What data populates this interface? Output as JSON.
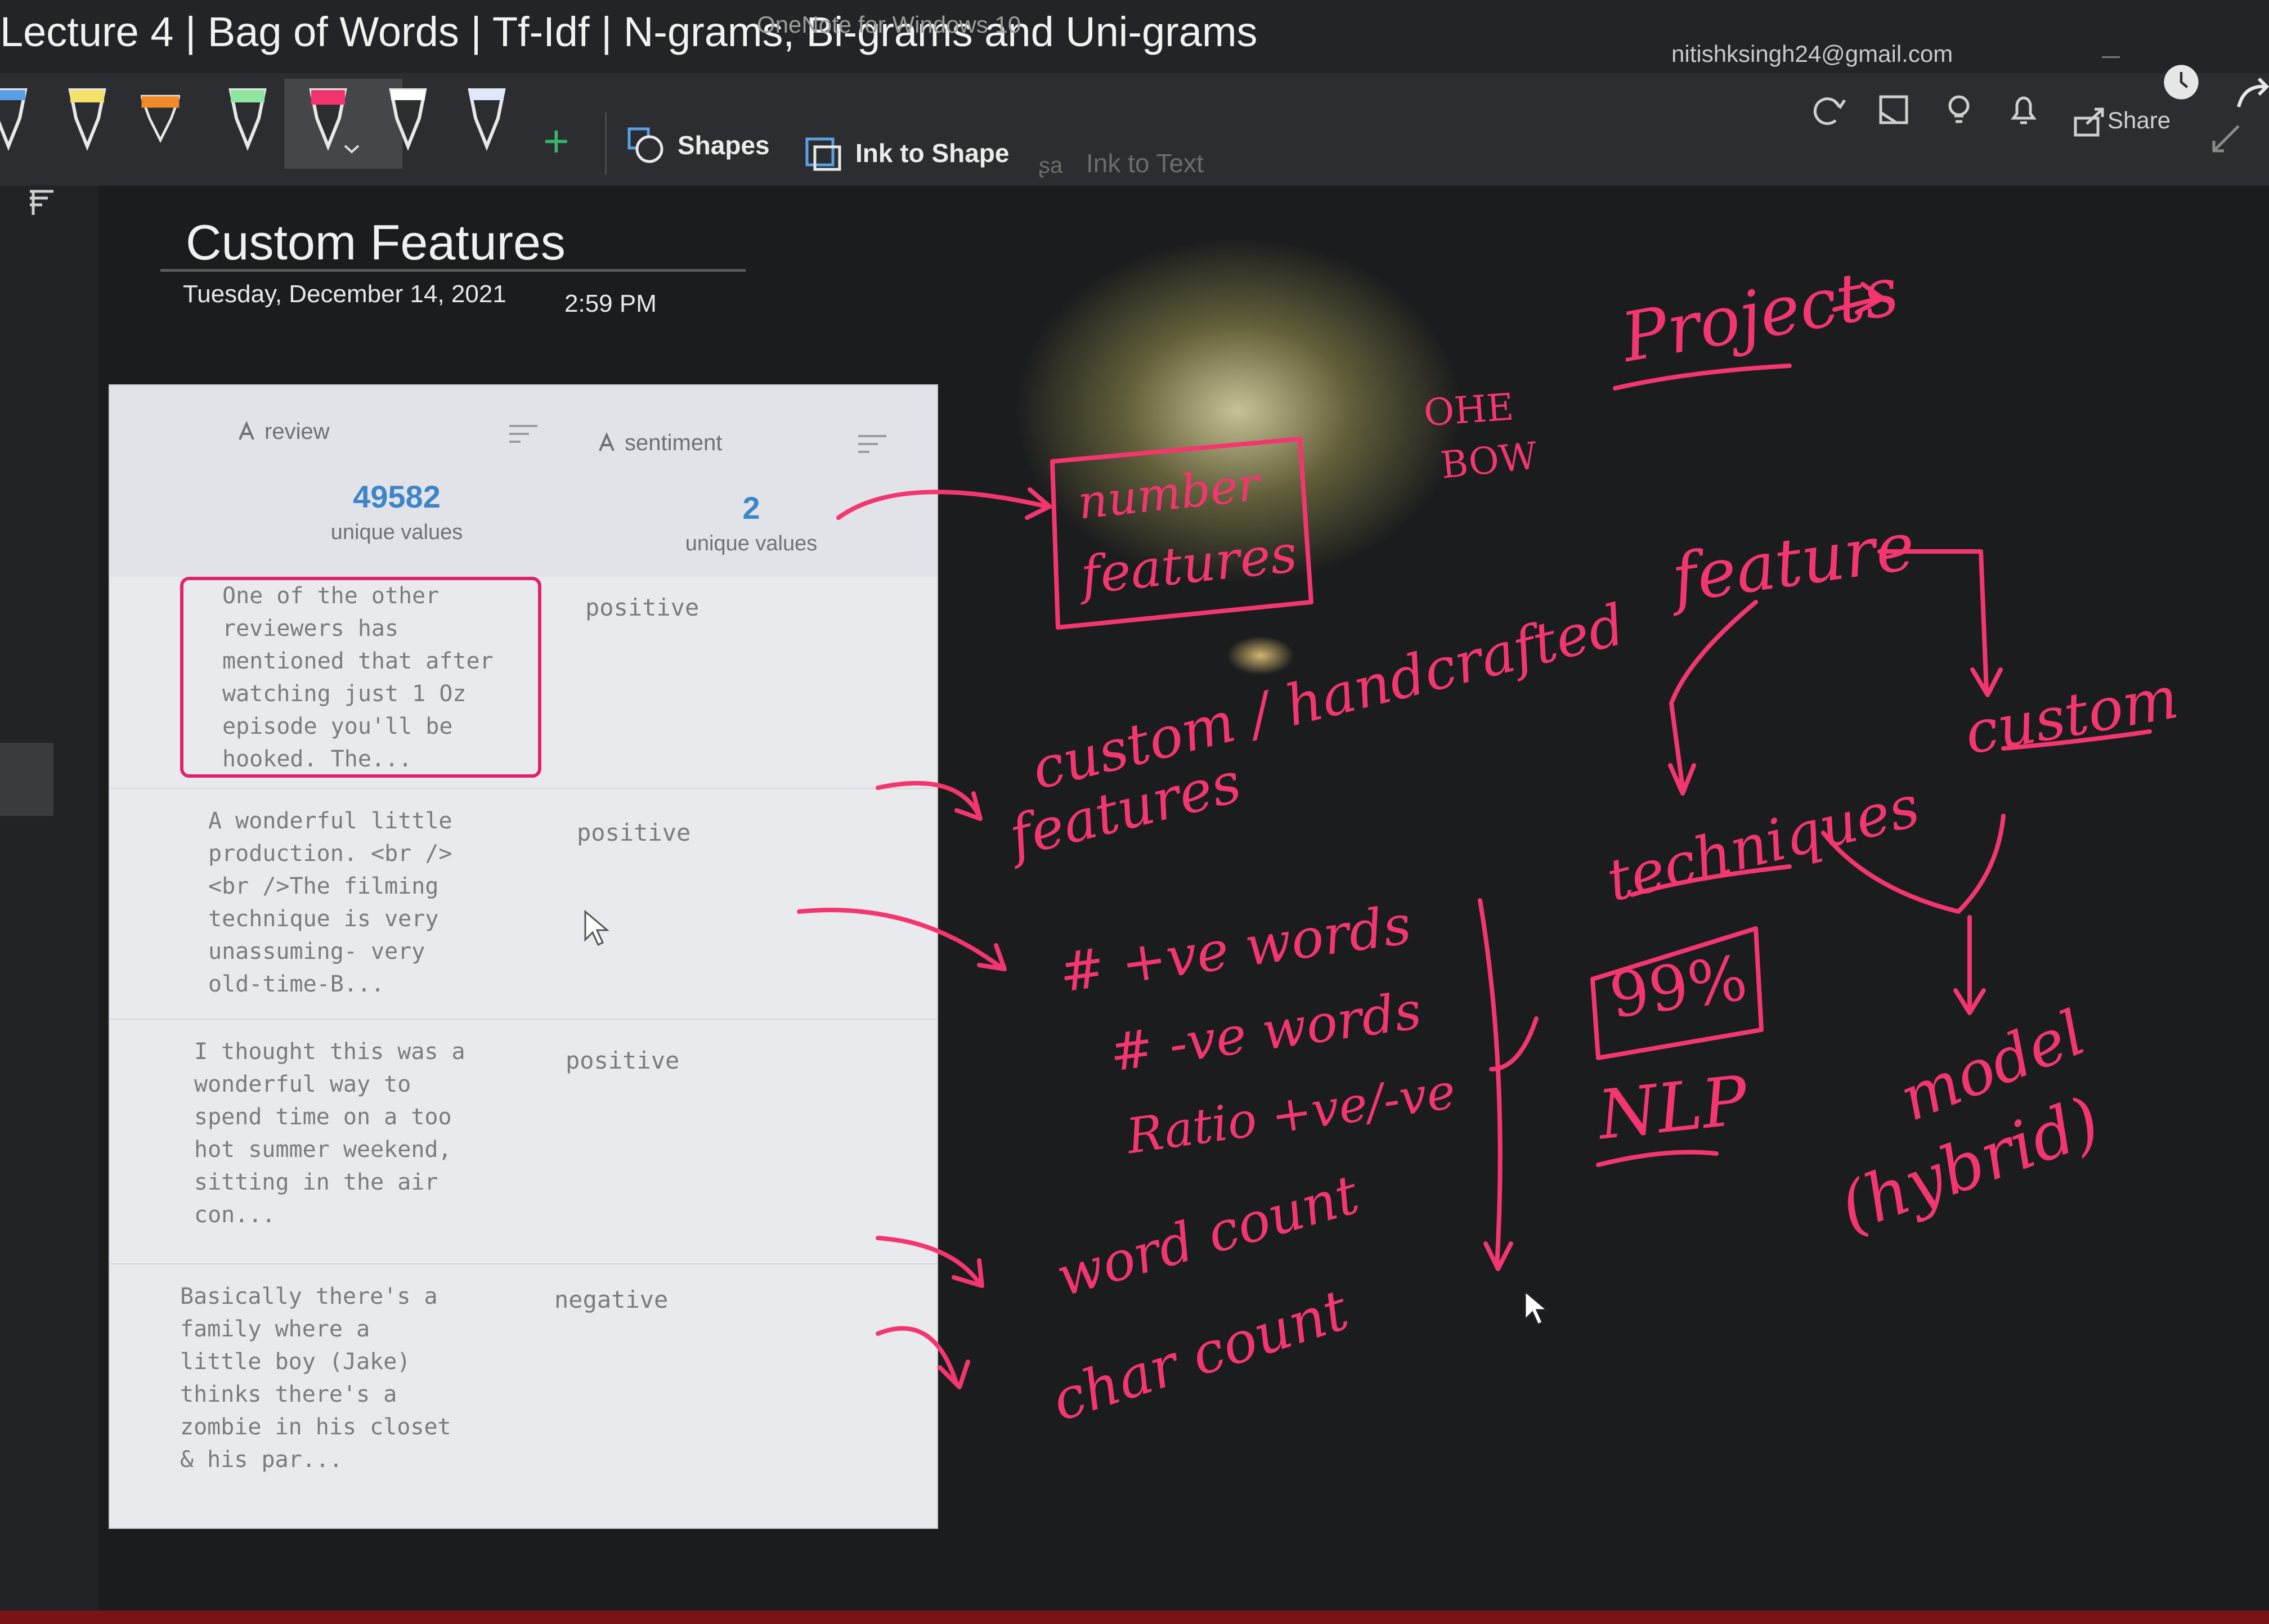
{
  "window": {
    "title": "Lecture 4 | Bag of Words | Tf-Idf | N-grams, Bi-grams and Uni-grams",
    "app_name": "OneNote for Windows 10",
    "account": "nitishksingh24@gmail.com"
  },
  "ribbon": {
    "pens": [
      {
        "icon": "pen-white-icon",
        "color": "#e6e6e6"
      },
      {
        "icon": "highlighter-yellow-icon",
        "color": "#f3e16a"
      },
      {
        "icon": "highlighter-orange-icon",
        "color": "#f08a2a"
      },
      {
        "icon": "pen-green-icon",
        "color": "#8fe6a0"
      },
      {
        "icon": "pen-pink-icon",
        "color": "#f0346e"
      },
      {
        "icon": "pen-white-icon",
        "color": "#ffffff"
      },
      {
        "icon": "pen-white-icon",
        "color": "#dfe7ff"
      }
    ],
    "shapes_label": "Shapes",
    "ink_to_shape_label": "Ink to Shape",
    "ink_to_text_label": "Ink to Text",
    "share_label": "Share"
  },
  "page": {
    "title": "Custom Features",
    "date": "Tuesday, December 14, 2021",
    "time": "2:59 PM"
  },
  "table": {
    "columns": [
      {
        "name": "review",
        "unique_count": "49582",
        "unique_label": "unique values"
      },
      {
        "name": "sentiment",
        "unique_count": "2",
        "unique_label": "unique values"
      }
    ],
    "rows": [
      {
        "review": "One of the other\nreviewers has\nmentioned that after\nwatching just 1 Oz\nepisode you'll be\nhooked. The...",
        "sentiment": "positive"
      },
      {
        "review": "A wonderful little\nproduction. <br />\n<br />The filming\ntechnique is very\nunassuming- very\nold-time-B...",
        "sentiment": "positive"
      },
      {
        "review": "I thought this was a\nwonderful way to\nspend time on a too\nhot summer weekend,\nsitting in the air\ncon...",
        "sentiment": "positive"
      },
      {
        "review": "Basically there's a\nfamily where a\nlittle boy (Jake)\nthinks there's a\nzombie in his closet\n& his par...",
        "sentiment": "negative"
      }
    ]
  },
  "ink": {
    "color": "#f3366f",
    "projects": "Projects",
    "ohe": "OHE",
    "bow": "BOW",
    "number": "number",
    "features": "features",
    "custom_handcrafted": "custom / handcrafted",
    "features2": "features",
    "pos_words": "# +ve words",
    "neg_words": "# -ve words",
    "ratio": "Ratio +ve/-ve",
    "word_count": "word count",
    "char_count": "char count",
    "feature": "feature",
    "custom": "custom",
    "techniques": "techniques",
    "score": "99%",
    "nlp": "NLP",
    "model": "model",
    "hybrid": "(hybrid)"
  }
}
